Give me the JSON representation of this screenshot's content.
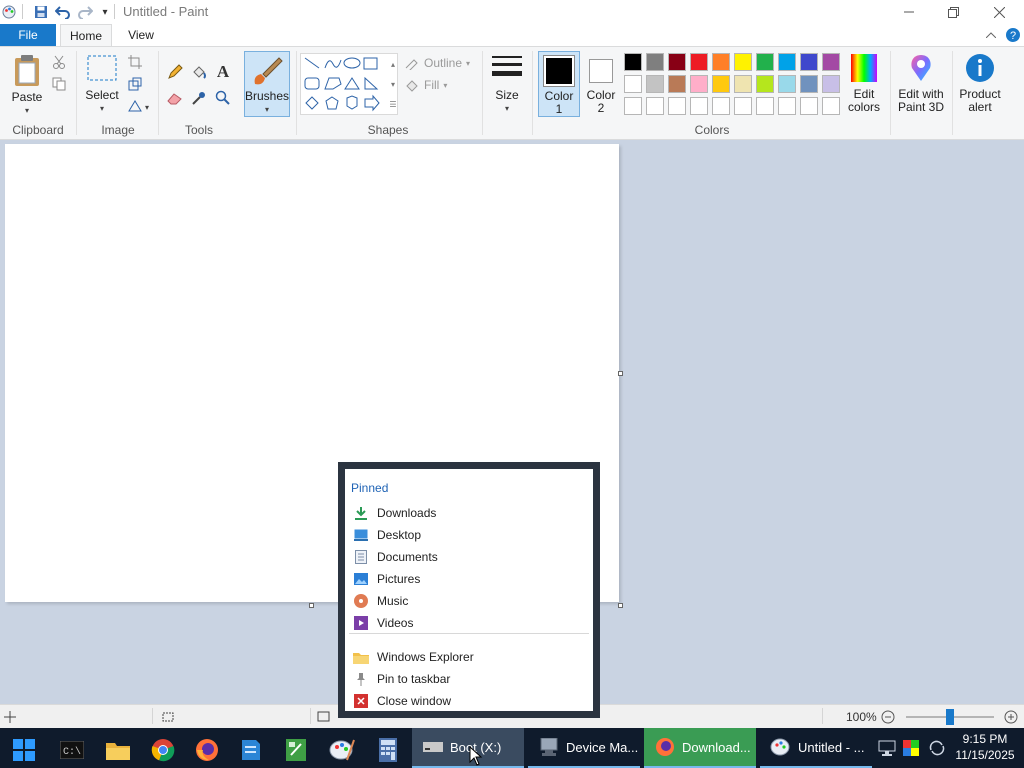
{
  "window": {
    "title": "Untitled - Paint"
  },
  "tabs": {
    "file": "File",
    "home": "Home",
    "view": "View"
  },
  "ribbon": {
    "clipboard": {
      "paste": "Paste",
      "group": "Clipboard"
    },
    "image": {
      "select": "Select",
      "group": "Image"
    },
    "tools": {
      "group": "Tools"
    },
    "brushes": {
      "label": "Brushes"
    },
    "shapes": {
      "outline": "Outline",
      "fill": "Fill",
      "group": "Shapes"
    },
    "size": {
      "label": "Size"
    },
    "colors": {
      "color1_line1": "Color",
      "color1_line2": "1",
      "color2_line1": "Color",
      "color2_line2": "2",
      "group": "Colors",
      "edit_line1": "Edit",
      "edit_line2": "colors",
      "row1": [
        "#000000",
        "#7f7f7f",
        "#880015",
        "#ed1c24",
        "#ff7f27",
        "#fff200",
        "#22b14c",
        "#00a2e8",
        "#3f48cc",
        "#a349a4"
      ],
      "row2": [
        "#ffffff",
        "#c3c3c3",
        "#b97a57",
        "#ffaec9",
        "#ffc90e",
        "#efe4b0",
        "#b5e61d",
        "#99d9ea",
        "#7092be",
        "#c8bfe7"
      ]
    },
    "paint3d": {
      "line1": "Edit with",
      "line2": "Paint 3D"
    },
    "alert": {
      "line1": "Product",
      "line2": "alert"
    }
  },
  "status": {
    "zoom": "100%",
    "zoom_level": 1.0
  },
  "jumplist": {
    "heading": "Pinned",
    "items": [
      "Downloads",
      "Desktop",
      "Documents",
      "Pictures",
      "Music",
      "Videos"
    ],
    "actions": [
      "Windows Explorer",
      "Pin to taskbar",
      "Close window"
    ]
  },
  "taskbar": {
    "tasks": [
      "Boot (X:)",
      "Device Ma...",
      "Download...",
      "Untitled - ..."
    ],
    "time": "9:15 PM",
    "date": "11/15/2025"
  },
  "colors": {
    "accent": "#1979ca",
    "taskbar": "#0f1b2c",
    "workspace": "#c9d3e2"
  }
}
